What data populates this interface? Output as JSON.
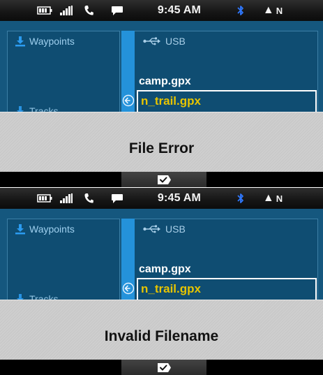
{
  "screens": [
    {
      "status_bar": {
        "time": "9:45 AM",
        "compass": "N"
      },
      "left_nav": {
        "items": [
          {
            "label": "Waypoints",
            "icon": "download-icon"
          },
          {
            "label": "Tracks",
            "icon": "download-icon"
          }
        ]
      },
      "file_list": {
        "source": {
          "label": "USB",
          "icon": "usb-icon"
        },
        "files": [
          {
            "name": "camp.gpx",
            "selected": false
          },
          {
            "name": "n_trail.gpx",
            "selected": true
          }
        ]
      },
      "dialog": {
        "message": "File Error"
      },
      "ok_button": {
        "icon": "checkmark-icon"
      }
    },
    {
      "status_bar": {
        "time": "9:45 AM",
        "compass": "N"
      },
      "left_nav": {
        "items": [
          {
            "label": "Waypoints",
            "icon": "download-icon"
          },
          {
            "label": "Tracks",
            "icon": "download-icon"
          }
        ]
      },
      "file_list": {
        "source": {
          "label": "USB",
          "icon": "usb-icon"
        },
        "files": [
          {
            "name": "camp.gpx",
            "selected": false
          },
          {
            "name": "n_trail.gpx",
            "selected": true
          }
        ]
      },
      "dialog": {
        "message": "Invalid Filename"
      },
      "ok_button": {
        "icon": "checkmark-icon"
      }
    }
  ],
  "colors": {
    "panel_bg": "#15577e",
    "scrollbar": "#2492da",
    "selected_text": "#e6c400",
    "dialog_bg": "#c9c9c9",
    "bluetooth": "#2f78ff"
  }
}
